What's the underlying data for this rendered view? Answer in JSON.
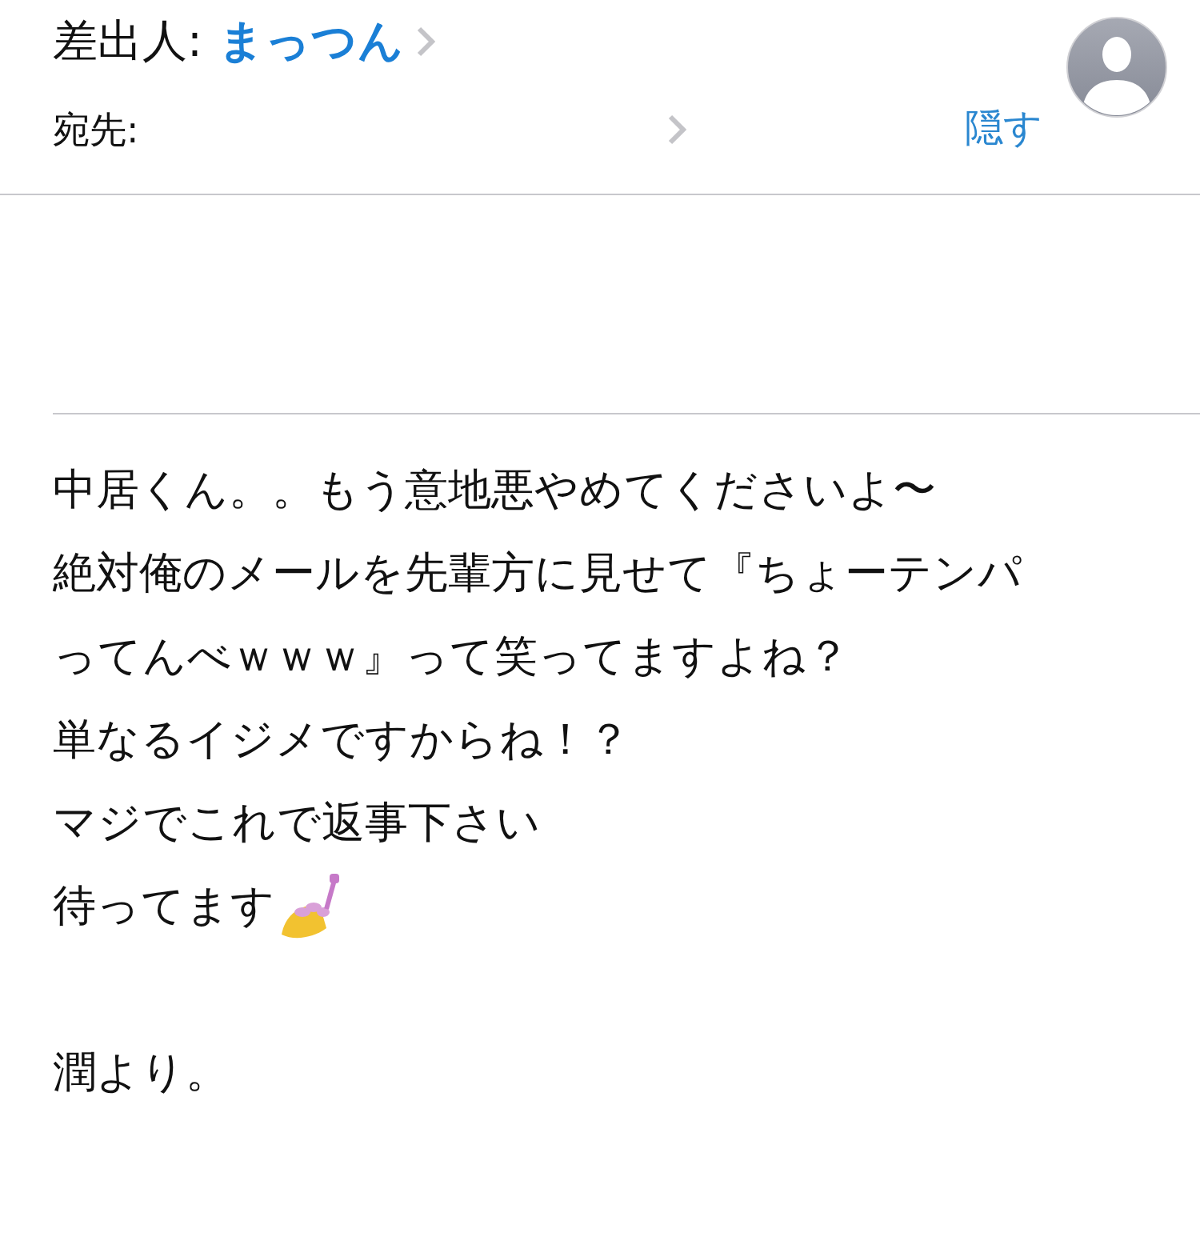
{
  "header": {
    "from_label": "差出人:",
    "from_name": "まっつん",
    "to_label": "宛先:",
    "hide_link": "隠す"
  },
  "body": {
    "lines": [
      "中居くん。。もう意地悪やめてくださいよ〜",
      "絶対俺のメールを先輩方に見せて『ちょーテンパ",
      "ってんべｗｗｗ』って笑ってますよね？",
      "単なるイジメですからね！？",
      "マジでこれで返事下さい",
      "待ってます"
    ],
    "signature": "潤より。"
  }
}
